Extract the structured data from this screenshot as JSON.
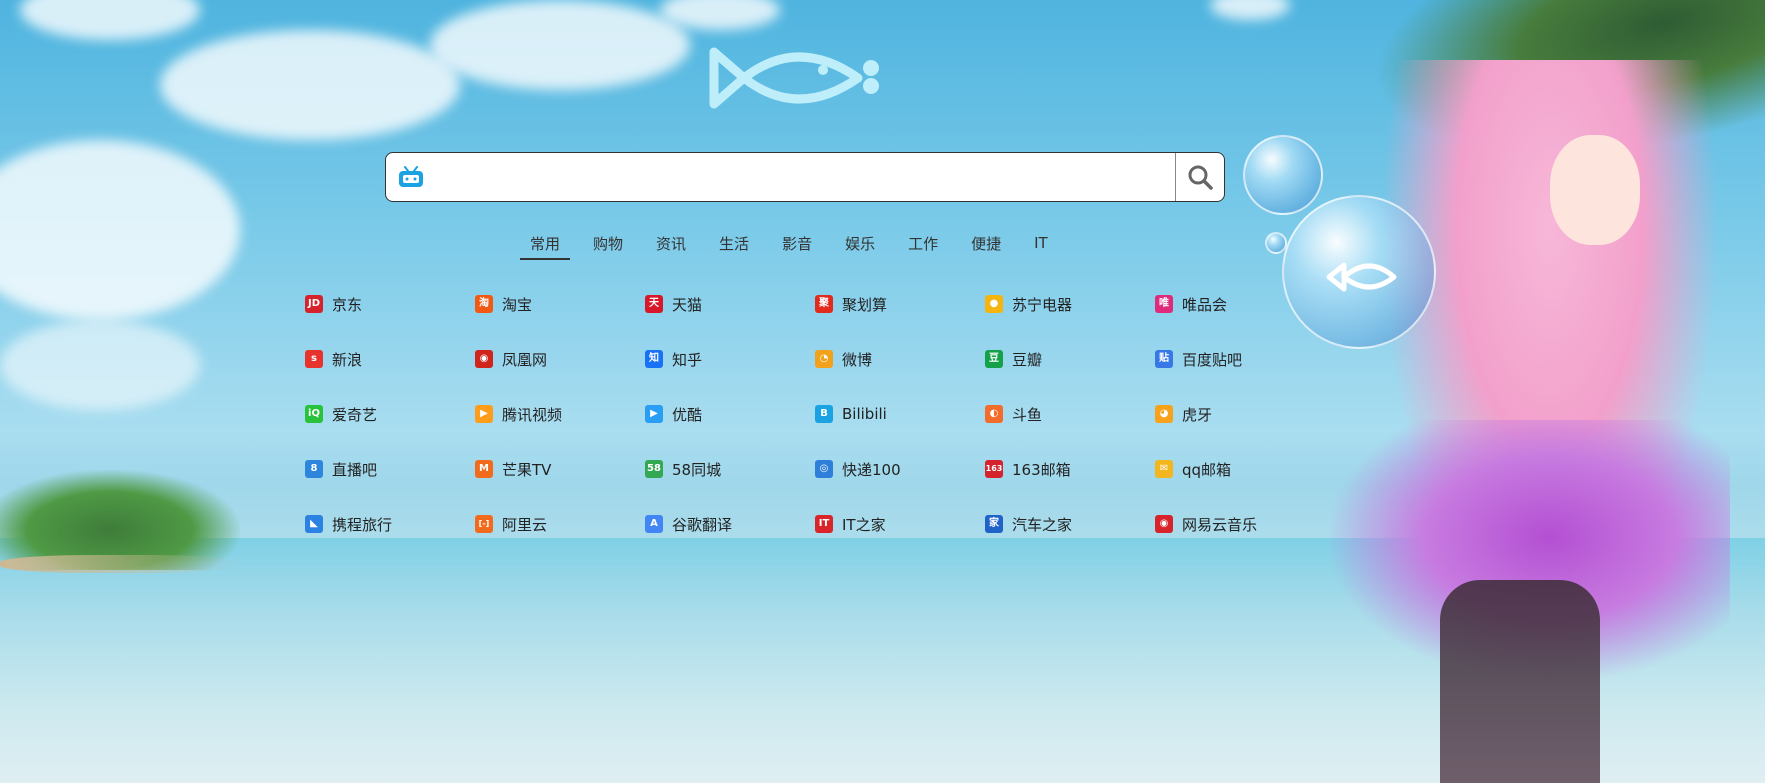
{
  "logo": {
    "icon": "fish-logo"
  },
  "search": {
    "engine_icon": "bilibili-tv-icon",
    "placeholder": "",
    "value": "",
    "submit_icon": "search-icon"
  },
  "tabs": [
    {
      "label": "常用",
      "active": true
    },
    {
      "label": "购物",
      "active": false
    },
    {
      "label": "资讯",
      "active": false
    },
    {
      "label": "生活",
      "active": false
    },
    {
      "label": "影音",
      "active": false
    },
    {
      "label": "娱乐",
      "active": false
    },
    {
      "label": "工作",
      "active": false
    },
    {
      "label": "便捷",
      "active": false
    },
    {
      "label": "IT",
      "active": false
    }
  ],
  "links": [
    {
      "label": "京东",
      "icon": "jd-icon",
      "glyph": "JD",
      "color": "#d6232b"
    },
    {
      "label": "淘宝",
      "icon": "taobao-icon",
      "glyph": "淘",
      "color": "#f25a14"
    },
    {
      "label": "天猫",
      "icon": "tmall-icon",
      "glyph": "天",
      "color": "#d9172a"
    },
    {
      "label": "聚划算",
      "icon": "juhuasuan-icon",
      "glyph": "聚",
      "color": "#e22a1d"
    },
    {
      "label": "苏宁电器",
      "icon": "suning-icon",
      "glyph": "●",
      "color": "#f5b511"
    },
    {
      "label": "唯品会",
      "icon": "vip-icon",
      "glyph": "唯",
      "color": "#e02b7c"
    },
    {
      "label": "新浪",
      "icon": "sina-icon",
      "glyph": "s",
      "color": "#e8322d"
    },
    {
      "label": "凤凰网",
      "icon": "ifeng-icon",
      "glyph": "◉",
      "color": "#d0251c"
    },
    {
      "label": "知乎",
      "icon": "zhihu-icon",
      "glyph": "知",
      "color": "#1772f6"
    },
    {
      "label": "微博",
      "icon": "weibo-icon",
      "glyph": "◔",
      "color": "#f2a21a"
    },
    {
      "label": "豆瓣",
      "icon": "douban-icon",
      "glyph": "豆",
      "color": "#15a04a"
    },
    {
      "label": "百度贴吧",
      "icon": "tieba-icon",
      "glyph": "贴",
      "color": "#3877e6"
    },
    {
      "label": "爱奇艺",
      "icon": "iqiyi-icon",
      "glyph": "iQ",
      "color": "#28c23b"
    },
    {
      "label": "腾讯视频",
      "icon": "tencent-video-icon",
      "glyph": "▶",
      "color": "#ff9c1a"
    },
    {
      "label": "优酷",
      "icon": "youku-icon",
      "glyph": "▶",
      "color": "#2a9df4"
    },
    {
      "label": "Bilibili",
      "icon": "bilibili-icon",
      "glyph": "B",
      "color": "#1ba2e2"
    },
    {
      "label": "斗鱼",
      "icon": "douyu-icon",
      "glyph": "◐",
      "color": "#f26d2b"
    },
    {
      "label": "虎牙",
      "icon": "huya-icon",
      "glyph": "◕",
      "color": "#f7a21a"
    },
    {
      "label": "直播吧",
      "icon": "zhibo8-icon",
      "glyph": "8",
      "color": "#2d86db"
    },
    {
      "label": "芒果TV",
      "icon": "mgtv-icon",
      "glyph": "M",
      "color": "#f26b1c"
    },
    {
      "label": "58同城",
      "icon": "58-icon",
      "glyph": "58",
      "color": "#33a853"
    },
    {
      "label": "快递100",
      "icon": "kuaidi100-icon",
      "glyph": "◎",
      "color": "#2e7fd9"
    },
    {
      "label": "163邮箱",
      "icon": "mail163-icon",
      "glyph": "163",
      "color": "#d5232e"
    },
    {
      "label": "qq邮箱",
      "icon": "qqmail-icon",
      "glyph": "✉",
      "color": "#f3b61e"
    },
    {
      "label": "携程旅行",
      "icon": "ctrip-icon",
      "glyph": "◣",
      "color": "#2b82e3"
    },
    {
      "label": "阿里云",
      "icon": "aliyun-icon",
      "glyph": "[-]",
      "color": "#f26a1b"
    },
    {
      "label": "谷歌翻译",
      "icon": "google-translate-icon",
      "glyph": "A",
      "color": "#4285f4"
    },
    {
      "label": "IT之家",
      "icon": "ithome-icon",
      "glyph": "IT",
      "color": "#d9252a"
    },
    {
      "label": "汽车之家",
      "icon": "autohome-icon",
      "glyph": "家",
      "color": "#1f63c9"
    },
    {
      "label": "网易云音乐",
      "icon": "netease-music-icon",
      "glyph": "◉",
      "color": "#d8232b"
    }
  ]
}
